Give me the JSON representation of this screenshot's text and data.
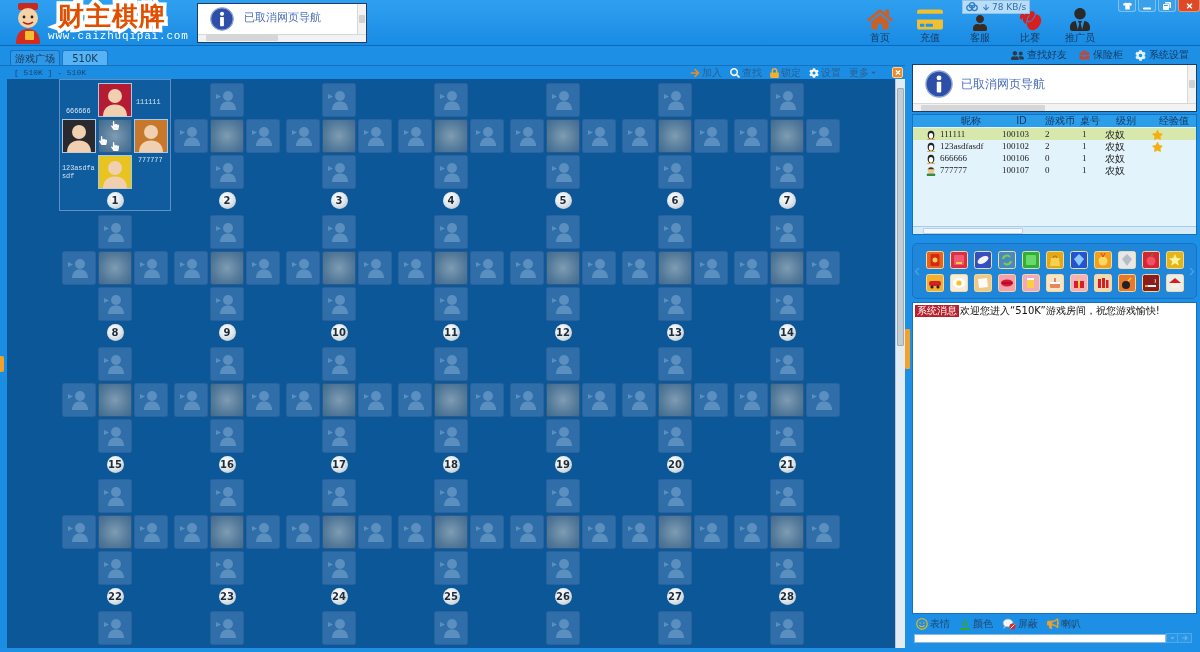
{
  "logo": {
    "title": "财主棋牌",
    "url": "www.caizhuqipai.com"
  },
  "header_frame": {
    "message": "已取消网页导航"
  },
  "nav": [
    {
      "label": "首页"
    },
    {
      "label": "充值"
    },
    {
      "label": "客服"
    },
    {
      "label": "比赛"
    },
    {
      "label": "推广员"
    }
  ],
  "speed_widget": {
    "reading": "78 KB/s"
  },
  "tabs": [
    {
      "label": "游戏广场",
      "selected": false
    },
    {
      "label": "510K",
      "selected": true
    }
  ],
  "toolbar": {
    "breadcrumb": "[ 510K ] - 510K",
    "actions": [
      {
        "label": "加入",
        "kind": "button"
      },
      {
        "label": "查找",
        "kind": "button"
      },
      {
        "label": "锁定",
        "kind": "button"
      },
      {
        "label": "设置",
        "kind": "button"
      },
      {
        "label": "更多",
        "kind": "dropdown"
      }
    ]
  },
  "tables": [
    {
      "number": "1",
      "selected": true,
      "seats": {
        "top": {
          "name": "111111",
          "ready": true
        },
        "left": {
          "name": "666666",
          "ready": true
        },
        "right": {
          "name": "777777",
          "ready": false
        },
        "bottom": {
          "name": "123asdfasdf",
          "ready": true
        }
      }
    },
    {
      "number": "2",
      "selected": false
    },
    {
      "number": "3",
      "selected": false
    },
    {
      "number": "4",
      "selected": false
    },
    {
      "number": "5",
      "selected": false
    },
    {
      "number": "6",
      "selected": false
    },
    {
      "number": "7",
      "selected": false
    },
    {
      "number": "8",
      "selected": false
    },
    {
      "number": "9",
      "selected": false
    },
    {
      "number": "10",
      "selected": false
    },
    {
      "number": "11",
      "selected": false
    },
    {
      "number": "12",
      "selected": false
    },
    {
      "number": "13",
      "selected": false
    },
    {
      "number": "14",
      "selected": false
    },
    {
      "number": "15",
      "selected": false
    },
    {
      "number": "16",
      "selected": false
    },
    {
      "number": "17",
      "selected": false
    },
    {
      "number": "18",
      "selected": false
    },
    {
      "number": "19",
      "selected": false
    },
    {
      "number": "20",
      "selected": false
    },
    {
      "number": "21",
      "selected": false
    },
    {
      "number": "22",
      "selected": false
    },
    {
      "number": "23",
      "selected": false
    },
    {
      "number": "24",
      "selected": false
    },
    {
      "number": "25",
      "selected": false
    },
    {
      "number": "26",
      "selected": false
    },
    {
      "number": "27",
      "selected": false
    },
    {
      "number": "28",
      "selected": false
    }
  ],
  "side_links": [
    {
      "label": "查找好友"
    },
    {
      "label": "保险柜"
    },
    {
      "label": "系统设置"
    }
  ],
  "side_frame": {
    "message": "已取消网页导航"
  },
  "user_list": {
    "columns": [
      "昵称",
      "ID",
      "游戏币",
      "桌号",
      "级别",
      "经验值"
    ],
    "rows": [
      {
        "kind": "penguin",
        "nickname": "111111",
        "id": "100103",
        "coins": "2",
        "table": "1",
        "level": "农奴",
        "star": true,
        "selected": true
      },
      {
        "kind": "penguin",
        "nickname": "123asdfasdf",
        "id": "100102",
        "coins": "2",
        "table": "1",
        "level": "农奴",
        "star": true,
        "selected": false
      },
      {
        "kind": "penguin",
        "nickname": "666666",
        "id": "100106",
        "coins": "0",
        "table": "1",
        "level": "农奴",
        "star": false,
        "selected": false
      },
      {
        "kind": "person",
        "nickname": "777777",
        "id": "100107",
        "coins": "0",
        "table": "1",
        "level": "农奴",
        "star": false,
        "selected": false
      }
    ]
  },
  "chat": {
    "messages": [
      {
        "tag": "系统消息",
        "text": "欢迎您进入“510K”游戏房间，祝您游戏愉快!"
      }
    ],
    "tools": [
      {
        "label": "表情"
      },
      {
        "label": "颜色"
      },
      {
        "label": "屏蔽"
      },
      {
        "label": "喇叭"
      }
    ]
  }
}
